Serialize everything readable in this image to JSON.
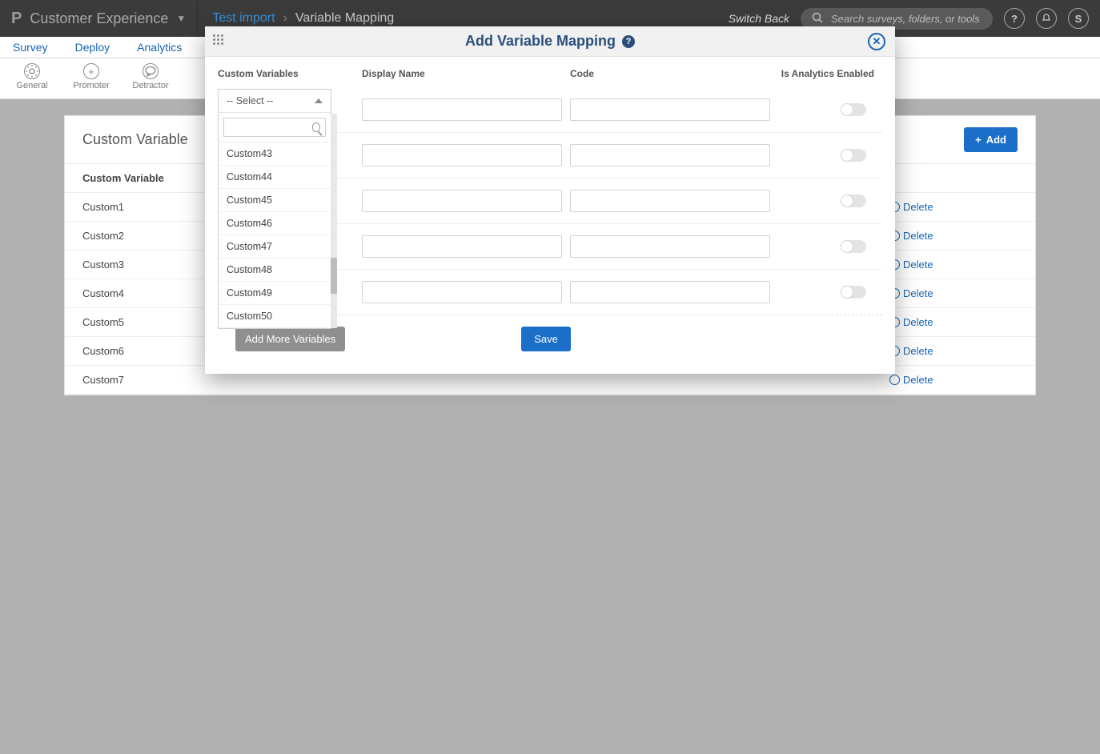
{
  "header": {
    "brand": "Customer Experience",
    "crumb_link": "Test import",
    "crumb_sep": "›",
    "crumb_current": "Variable Mapping",
    "switch_back": "Switch Back",
    "search_placeholder": "Search surveys, folders, or tools",
    "help": "?",
    "user_initial": "S"
  },
  "tabs": {
    "survey": "Survey",
    "deploy": "Deploy",
    "analytics": "Analytics"
  },
  "toolbar": {
    "general": "General",
    "promoter": "Promoter",
    "detractor": "Detractor"
  },
  "panel": {
    "title": "Custom Variable",
    "add": "Add",
    "col_variable": "Custom Variable",
    "rows": [
      "Custom1",
      "Custom2",
      "Custom3",
      "Custom4",
      "Custom5",
      "Custom6",
      "Custom7"
    ],
    "delete": "Delete"
  },
  "modal": {
    "title": "Add Variable Mapping",
    "cols": {
      "custom": "Custom Variables",
      "display": "Display Name",
      "code": "Code",
      "analytics": "Is Analytics Enabled"
    },
    "select_placeholder": "-- Select --",
    "options": [
      "Custom43",
      "Custom44",
      "Custom45",
      "Custom46",
      "Custom47",
      "Custom48",
      "Custom49",
      "Custom50"
    ],
    "add_more": "Add More Variables",
    "save": "Save"
  }
}
